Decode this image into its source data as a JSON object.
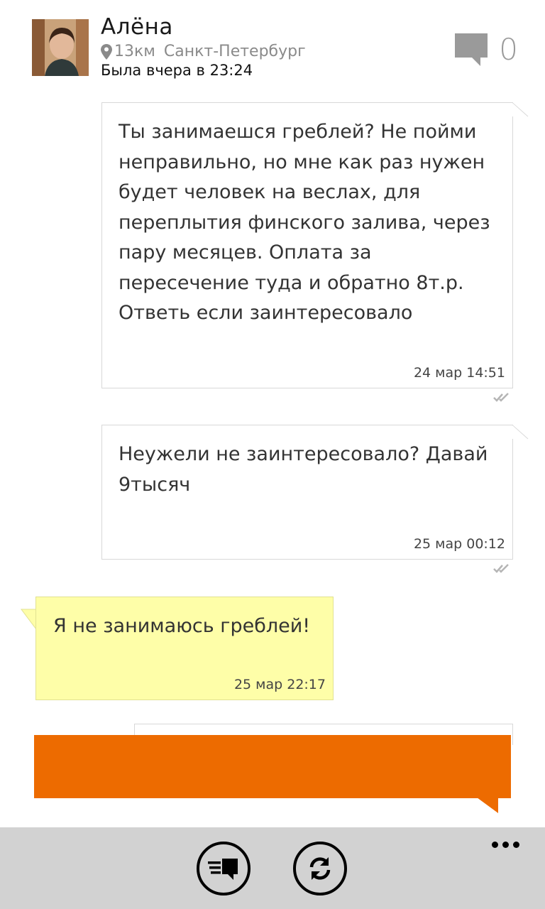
{
  "header": {
    "name": "Алёна",
    "distance": "13км",
    "city": "Санкт-Петербург",
    "last_seen": "Была вчера в 23:24",
    "message_count": "0"
  },
  "messages": [
    {
      "direction": "incoming",
      "text": "Ты занимаешся греблей? Не пойми неправильно, но мне как раз нужен будет человек на веслах, для переплытия финского залива, через пару месяцев. Оплата за пересечение туда и обратно 8т.р. Ответь если заинтересовало",
      "time": "24 мар 14:51"
    },
    {
      "direction": "incoming",
      "text": "Неужели не заинтересовало? Давай 9тысяч",
      "time": "25 мар 00:12"
    },
    {
      "direction": "outgoing",
      "text": "Я не занимаюсь греблей!",
      "time": "25 мар 22:17"
    }
  ],
  "colors": {
    "accent_orange": "#ED6B00",
    "own_bubble": "#FEFEA8",
    "app_bar": "#D2D2D2"
  },
  "icons": {
    "location": "map-pin-icon",
    "message_counter": "speech-bubble-icon",
    "messages_button": "message-list-icon",
    "refresh_button": "refresh-icon",
    "more": "ellipsis-icon",
    "read_status": "double-check-icon"
  }
}
